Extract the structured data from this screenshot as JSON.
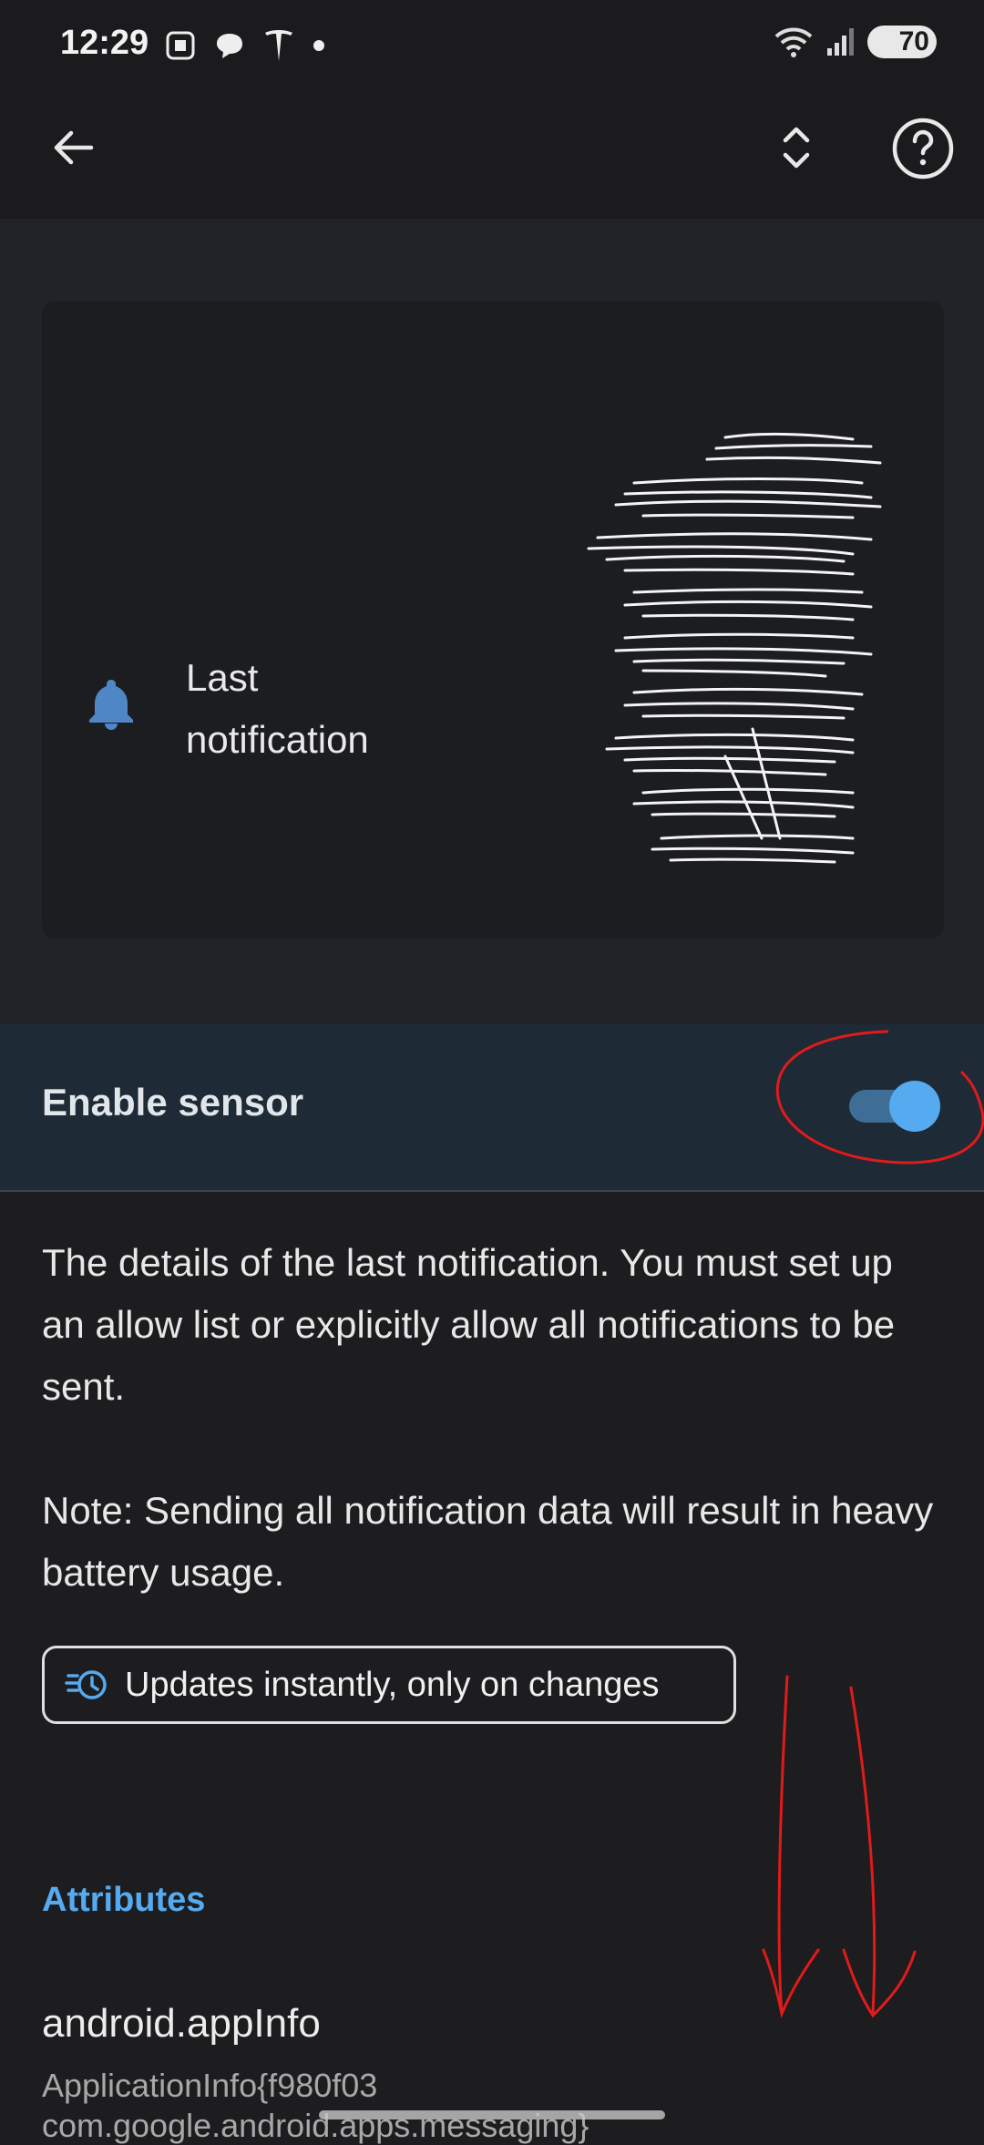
{
  "status_bar": {
    "time": "12:29",
    "left_icons": [
      "screenshot-icon",
      "chat-icon",
      "tesla-icon",
      "dot-icon"
    ],
    "right_icons": [
      "wifi-icon",
      "signal-icon"
    ],
    "battery": "70"
  },
  "app_bar": {
    "back_icon": "arrow-left-icon",
    "expand_icon": "unfold-icon",
    "help_icon": "help-circle-icon"
  },
  "sensor_card": {
    "title": "Last notification",
    "icon": "bell-icon",
    "state_redacted": true
  },
  "enable_sensor": {
    "label": "Enable sensor",
    "enabled": true
  },
  "description": {
    "paragraph1": "The details of the last notification. You must set up an allow list or explicitly allow all notifications to be sent.",
    "paragraph2": "Note: Sending all notification data will result in heavy battery usage."
  },
  "update_chip": {
    "icon": "update-history-icon",
    "label": "Updates instantly, only on changes"
  },
  "attributes": {
    "heading": "Attributes",
    "items": [
      {
        "name": "android.appInfo",
        "value_line1": "ApplicationInfo{f980f03",
        "value_line2": "com.google.android.apps.messaging}"
      }
    ]
  },
  "colors": {
    "accent": "#55aaf0",
    "background": "#1d1d1f",
    "hero": "#212329",
    "enable_row": "#1e2a35",
    "annotation": "#e01b1b"
  }
}
